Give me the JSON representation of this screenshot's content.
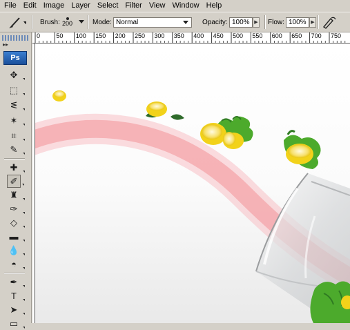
{
  "menu": [
    "File",
    "Edit",
    "Image",
    "Layer",
    "Select",
    "Filter",
    "View",
    "Window",
    "Help"
  ],
  "options": {
    "brush_label": "Brush:",
    "brush_size": "200",
    "mode_label": "Mode:",
    "mode_value": "Normal",
    "opacity_label": "Opacity:",
    "opacity_value": "100%",
    "flow_label": "Flow:",
    "flow_value": "100%"
  },
  "ruler": {
    "ticks": [
      "0",
      "50",
      "100",
      "150",
      "200",
      "250",
      "300",
      "350",
      "400",
      "450",
      "500",
      "550",
      "600",
      "650",
      "700",
      "750"
    ]
  },
  "toolbox": {
    "logo": "Ps",
    "tools": [
      {
        "name": "move-tool-icon",
        "glyph": "✥"
      },
      {
        "name": "marquee-tool-icon",
        "glyph": "⬚"
      },
      {
        "name": "lasso-tool-icon",
        "glyph": "ᓬ"
      },
      {
        "name": "magic-wand-tool-icon",
        "glyph": "✶"
      },
      {
        "name": "crop-tool-icon",
        "glyph": "⌗"
      },
      {
        "name": "slice-tool-icon",
        "glyph": "✎"
      },
      {
        "name": "healing-brush-tool-icon",
        "glyph": "✚"
      },
      {
        "name": "brush-tool-icon",
        "glyph": "✐"
      },
      {
        "name": "clone-stamp-tool-icon",
        "glyph": "♜"
      },
      {
        "name": "history-brush-tool-icon",
        "glyph": "✑"
      },
      {
        "name": "eraser-tool-icon",
        "glyph": "◇"
      },
      {
        "name": "gradient-tool-icon",
        "glyph": "▬"
      },
      {
        "name": "blur-tool-icon",
        "glyph": "💧"
      },
      {
        "name": "dodge-tool-icon",
        "glyph": "◓"
      },
      {
        "name": "pen-tool-icon",
        "glyph": "✒"
      },
      {
        "name": "type-tool-icon",
        "glyph": "T"
      },
      {
        "name": "path-selection-tool-icon",
        "glyph": "➤"
      },
      {
        "name": "shape-tool-icon",
        "glyph": "▭"
      }
    ]
  },
  "colors": {
    "chrome": "#d4d0c8",
    "stroke": "#f48a90",
    "lemon": "#f2d21a",
    "leaf": "#4caa2c"
  }
}
